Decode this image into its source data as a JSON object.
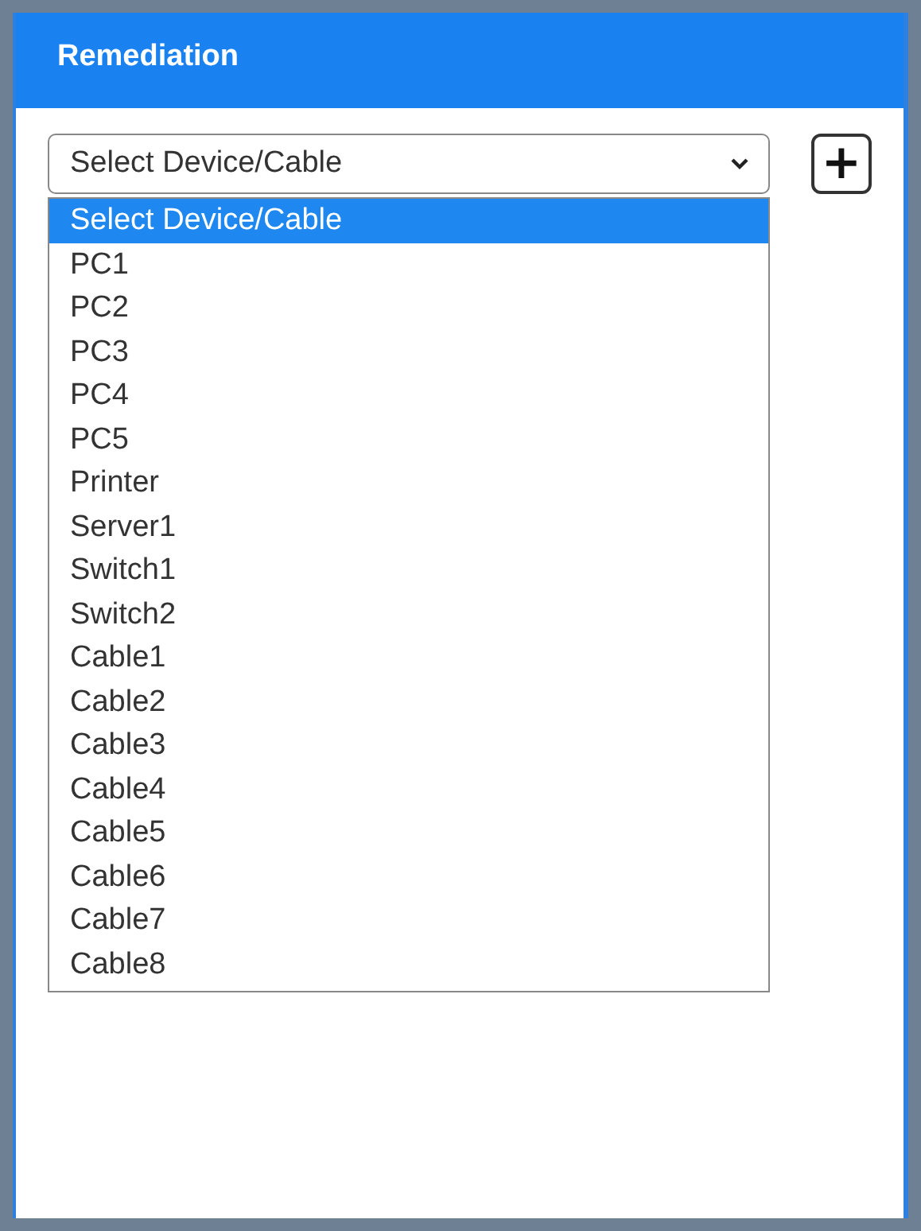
{
  "panel": {
    "title": "Remediation"
  },
  "select": {
    "value": "Select Device/Cable"
  },
  "add_button": {
    "label": "+"
  },
  "options": [
    {
      "label": "Select Device/Cable",
      "selected": true
    },
    {
      "label": "PC1",
      "selected": false
    },
    {
      "label": "PC2",
      "selected": false
    },
    {
      "label": "PC3",
      "selected": false
    },
    {
      "label": "PC4",
      "selected": false
    },
    {
      "label": "PC5",
      "selected": false
    },
    {
      "label": "Printer",
      "selected": false
    },
    {
      "label": "Server1",
      "selected": false
    },
    {
      "label": "Switch1",
      "selected": false
    },
    {
      "label": "Switch2",
      "selected": false
    },
    {
      "label": "Cable1",
      "selected": false
    },
    {
      "label": "Cable2",
      "selected": false
    },
    {
      "label": "Cable3",
      "selected": false
    },
    {
      "label": "Cable4",
      "selected": false
    },
    {
      "label": "Cable5",
      "selected": false
    },
    {
      "label": "Cable6",
      "selected": false
    },
    {
      "label": "Cable7",
      "selected": false
    },
    {
      "label": "Cable8",
      "selected": false
    }
  ]
}
